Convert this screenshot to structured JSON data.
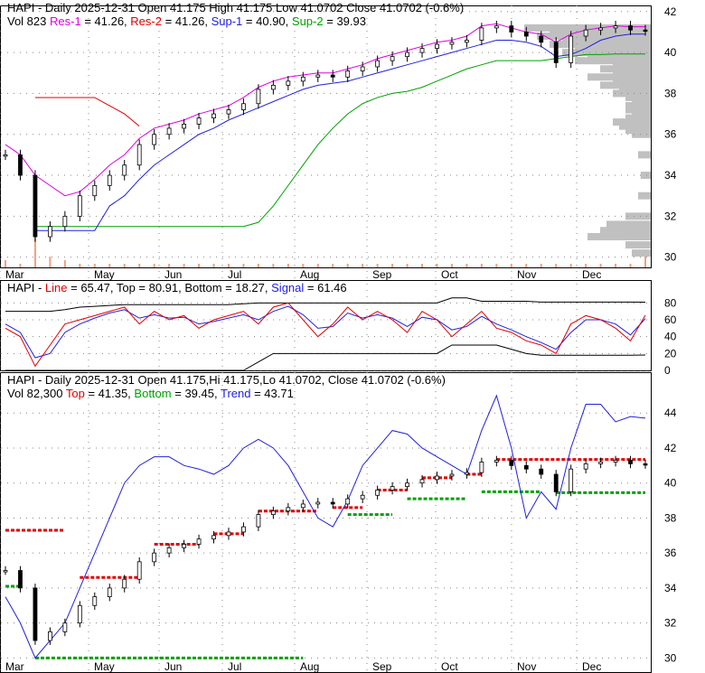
{
  "chart_data": [
    {
      "type": "candlestick",
      "title": "HAPI - Daily 2025-12-31",
      "header": {
        "line1": {
          "prefix": "HAPI - Daily 2025-12-31 Open 41.175  High 41.175  Low 41.0702  Close 41.0702 (-0.6%)"
        },
        "vol": "Vol 823",
        "res1_label": "Res-1",
        "res1": "= 41.26,",
        "res2_label": "Res-2",
        "res2": "= 41.26,",
        "sup1_label": "Sup-1",
        "sup1": "= 40.90,",
        "sup2_label": "Sup-2",
        "sup2": "= 39.93"
      },
      "y_ticks": [
        "42",
        "40",
        "38",
        "36",
        "34",
        "32",
        "30"
      ],
      "ylim": [
        29.5,
        42.3
      ],
      "x_ticks": [
        "Mar",
        "May",
        "Jun",
        "Jul",
        "Aug",
        "Sep",
        "Oct",
        "Nov",
        "Dec"
      ],
      "closes_weekly": [
        35,
        34,
        31,
        31.5,
        32,
        33,
        33.5,
        34,
        34.5,
        35.5,
        36,
        36.3,
        36.5,
        36.8,
        37,
        37.2,
        37.5,
        38.2,
        38.4,
        38.6,
        38.8,
        38.9,
        38.8,
        39.1,
        39.3,
        39.6,
        39.8,
        40,
        40.2,
        40.4,
        40.5,
        40.6,
        41.2,
        41.3,
        41,
        40.8,
        40.5,
        39.5,
        40.8,
        41.1,
        41.2,
        41.3,
        41.1,
        41.07
      ],
      "sup1_weekly": [
        null,
        null,
        31.3,
        31.3,
        31.3,
        31.3,
        31.3,
        32.5,
        33,
        33.8,
        34.5,
        35,
        35.5,
        36,
        36.3,
        36.7,
        37,
        37.3,
        37.6,
        37.9,
        38.2,
        38.4,
        38.5,
        38.6,
        38.8,
        39,
        39.2,
        39.4,
        39.6,
        39.8,
        40,
        40.2,
        40.4,
        40.6,
        40.6,
        40.5,
        40.3,
        39.8,
        39.9,
        40.2,
        40.6,
        40.8,
        40.9,
        40.9
      ],
      "sup2_weekly": [
        null,
        null,
        31.5,
        31.5,
        31.5,
        31.5,
        31.5,
        31.5,
        31.5,
        31.5,
        31.5,
        31.5,
        31.5,
        31.5,
        31.5,
        31.5,
        31.5,
        31.7,
        32.5,
        33.5,
        34.5,
        35.5,
        36.3,
        37,
        37.5,
        37.8,
        38,
        38.1,
        38.3,
        38.6,
        38.9,
        39.2,
        39.4,
        39.6,
        39.6,
        39.6,
        39.6,
        39.7,
        39.8,
        39.9,
        39.9,
        39.93,
        39.93,
        39.93
      ],
      "res1_weekly": [
        35.5,
        35,
        34,
        33.5,
        33,
        33.2,
        33.8,
        34.5,
        35,
        35.8,
        36.3,
        36.5,
        36.7,
        37,
        37.2,
        37.4,
        37.8,
        38.3,
        38.6,
        38.8,
        38.9,
        39,
        39,
        39.2,
        39.4,
        39.7,
        39.9,
        40.1,
        40.3,
        40.5,
        40.6,
        40.8,
        41.3,
        41.4,
        41.2,
        41,
        40.9,
        40.5,
        40.9,
        41.1,
        41.2,
        41.3,
        41.26,
        41.26
      ],
      "res2_weekly": [
        null,
        null,
        37.8,
        37.8,
        37.8,
        37.8,
        37.8,
        37.4,
        37,
        36.4,
        null,
        null,
        null,
        null,
        null,
        null,
        null,
        null,
        null,
        null,
        null,
        null,
        null,
        null,
        null,
        null,
        null,
        null,
        null,
        null,
        null,
        null,
        null,
        null,
        null,
        null,
        null,
        null,
        null,
        null,
        null,
        null,
        null,
        null
      ],
      "volume_weekly": [
        0.2,
        0.1,
        1,
        0.3,
        0.2,
        0.1,
        0.1,
        0.1,
        0.1,
        0.1,
        0.1,
        0.1,
        0.1,
        0.1,
        0.1,
        0.1,
        0.1,
        0.1,
        0.1,
        0.1,
        0.1,
        0.1,
        0.1,
        0.1,
        0.1,
        0.1,
        0.1,
        0.1,
        0.1,
        0.1,
        0.1,
        0.1,
        0.1,
        0.1,
        0.1,
        0.1,
        0.1,
        0.1,
        0.1,
        0.1,
        0.1,
        0.1,
        0.1,
        0.3
      ],
      "volume_profile": [
        [
          41.2,
          1
        ],
        [
          41,
          0.8
        ],
        [
          40.8,
          0.9
        ],
        [
          40.6,
          0.7
        ],
        [
          40.4,
          0.8
        ],
        [
          40.2,
          0.6
        ],
        [
          40,
          0.7
        ],
        [
          39.8,
          0.5
        ],
        [
          39.6,
          0.6
        ],
        [
          39.4,
          0.3
        ],
        [
          39.2,
          0.4
        ],
        [
          39,
          0.3
        ],
        [
          38.8,
          0.5
        ],
        [
          38.6,
          0.3
        ],
        [
          38.4,
          0.4
        ],
        [
          38.2,
          0.25
        ],
        [
          38,
          0.3
        ],
        [
          37.8,
          0.2
        ],
        [
          37.6,
          0.15
        ],
        [
          37.4,
          0.2
        ],
        [
          37.2,
          0.2
        ],
        [
          37,
          0.15
        ],
        [
          36.8,
          0.2
        ],
        [
          36.6,
          0.3
        ],
        [
          36.4,
          0.25
        ],
        [
          36.2,
          0.2
        ],
        [
          36,
          0.15
        ],
        [
          35,
          0.1
        ],
        [
          34,
          0.08
        ],
        [
          33,
          0.1
        ],
        [
          32,
          0.2
        ],
        [
          31.6,
          0.35
        ],
        [
          31.3,
          0.4
        ],
        [
          31,
          0.5
        ],
        [
          30.6,
          0.2
        ],
        [
          30.2,
          0.15
        ]
      ]
    },
    {
      "type": "line",
      "title": "HAPI - Line",
      "header": {
        "prefix": "HAPI - ",
        "line_label": "Line",
        "line_val": "= 65.47, Top = 80.91, Bottom = 18.27,",
        "signal_label": "Signal",
        "signal_val": "= 61.46"
      },
      "y_ticks": [
        "80",
        "60",
        "40",
        "20",
        "0"
      ],
      "ylim": [
        0,
        90
      ],
      "line_weekly": [
        50,
        40,
        5,
        30,
        55,
        60,
        65,
        70,
        75,
        55,
        70,
        60,
        65,
        50,
        60,
        65,
        70,
        55,
        75,
        80,
        60,
        40,
        55,
        75,
        60,
        70,
        60,
        45,
        70,
        60,
        40,
        55,
        70,
        50,
        45,
        35,
        30,
        20,
        55,
        65,
        60,
        50,
        35,
        65.47
      ],
      "signal_weekly": [
        55,
        45,
        15,
        20,
        45,
        55,
        62,
        68,
        72,
        62,
        66,
        62,
        63,
        55,
        58,
        62,
        66,
        60,
        70,
        76,
        66,
        50,
        52,
        68,
        62,
        66,
        62,
        52,
        63,
        60,
        48,
        52,
        64,
        55,
        48,
        40,
        33,
        25,
        45,
        60,
        60,
        55,
        42,
        61.46
      ],
      "top_weekly": [
        70,
        70,
        70,
        70,
        72,
        75,
        76,
        77,
        78,
        78,
        78,
        78,
        78,
        78,
        78,
        78,
        79,
        80,
        80,
        80,
        80,
        80,
        80,
        80,
        80,
        80,
        80,
        80,
        80,
        80,
        86,
        86,
        82,
        82,
        82,
        82,
        81,
        81,
        81,
        81,
        81,
        81,
        81,
        80.91
      ],
      "bottom_weekly": [
        0,
        0,
        0,
        0,
        0,
        0,
        0,
        0,
        0,
        0,
        0,
        0,
        0,
        0,
        0,
        0,
        0,
        10,
        20,
        20,
        20,
        20,
        20,
        20,
        20,
        20,
        20,
        20,
        20,
        20,
        30,
        30,
        30,
        30,
        25,
        20,
        18,
        18,
        18,
        18,
        18,
        18,
        18,
        18.27
      ]
    },
    {
      "type": "candlestick",
      "title": "HAPI - Daily 2025-12-31 (trend)",
      "header": {
        "line1": "HAPI - Daily 2025-12-31 Open 41.175,Hi 41.175,Lo 41.0702, Close 41.0702 (-0.6%)",
        "vol": "Vol 82,300",
        "top_label": "Top",
        "top_val": "= 41.35,",
        "bottom_label": "Bottom",
        "bottom_val": "= 39.45,",
        "trend_label": "Trend",
        "trend_val": "= 43.71"
      },
      "y_ticks": [
        "44",
        "42",
        "40",
        "38",
        "36",
        "34",
        "32",
        "30"
      ],
      "ylim": [
        29.4,
        45.2
      ],
      "trend_weekly": [
        33.5,
        32,
        30,
        31,
        32,
        34,
        36,
        38,
        40,
        41,
        41.5,
        41.5,
        41,
        40.8,
        40.5,
        41,
        42,
        42.5,
        42,
        41,
        39.5,
        38,
        37.5,
        39,
        41,
        42,
        43,
        42.8,
        42,
        41.5,
        41,
        40.5,
        43,
        45,
        42,
        38,
        39.5,
        38.5,
        42,
        44.5,
        44.5,
        43.5,
        43.8,
        43.71
      ],
      "top_segments": [
        [
          0,
          4,
          37.3
        ],
        [
          5,
          9,
          34.6
        ],
        [
          10,
          13,
          36.5
        ],
        [
          14,
          16,
          37.1
        ],
        [
          17,
          21,
          38.4
        ],
        [
          22,
          24,
          38.6
        ],
        [
          25,
          27,
          39.6
        ],
        [
          28,
          30,
          40.3
        ],
        [
          31,
          32,
          40.5
        ],
        [
          33,
          44,
          41.35
        ]
      ],
      "bottom_segments": [
        [
          0,
          1,
          34.1
        ],
        [
          2,
          20,
          30
        ],
        [
          23,
          26,
          38.2
        ],
        [
          27,
          31,
          39.1
        ],
        [
          32,
          36,
          39.5
        ],
        [
          37,
          44,
          39.45
        ]
      ]
    }
  ]
}
